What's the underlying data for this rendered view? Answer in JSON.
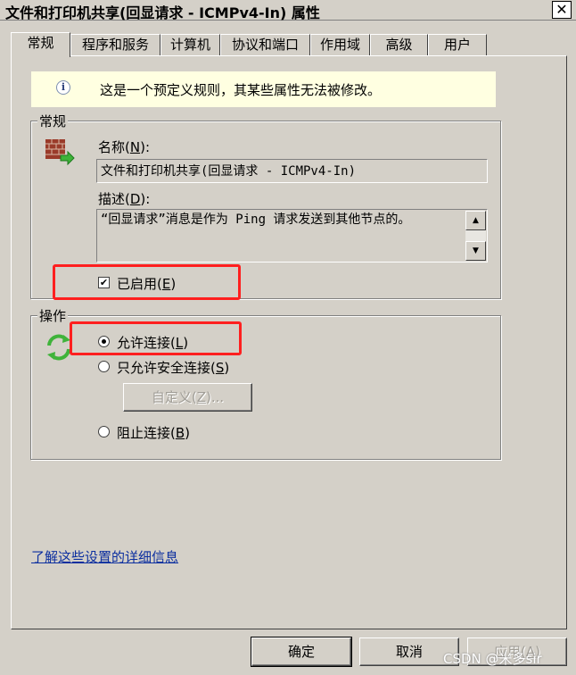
{
  "window": {
    "title": "文件和打印机共享(回显请求 - ICMPv4-In) 属性",
    "close_glyph": "✕"
  },
  "tabs": [
    {
      "label": "常规",
      "active": true
    },
    {
      "label": "程序和服务",
      "active": false
    },
    {
      "label": "计算机",
      "active": false
    },
    {
      "label": "协议和端口",
      "active": false
    },
    {
      "label": "作用域",
      "active": false
    },
    {
      "label": "高级",
      "active": false
    },
    {
      "label": "用户",
      "active": false
    }
  ],
  "info": {
    "icon": "info-icon",
    "icon_glyph": "i",
    "text": "这是一个预定义规则，其某些属性无法被修改。",
    "background": "#ffffe1"
  },
  "general": {
    "group_title": "常规",
    "icon": "firewall-brick-icon",
    "name_label_pre": "名称(",
    "name_label_key": "N",
    "name_label_post": "):",
    "name_value": "文件和打印机共享(回显请求 - ICMPv4-In)",
    "desc_label_pre": "描述(",
    "desc_label_key": "D",
    "desc_label_post": "):",
    "desc_value": "“回显请求”消息是作为 Ping 请求发送到其他节点的。",
    "enabled_checked": true,
    "enabled_check_glyph": "✔",
    "enabled_label_pre": "已启用(",
    "enabled_label_key": "E",
    "enabled_label_post": ")"
  },
  "action": {
    "group_title": "操作",
    "icon": "refresh-arrows-icon",
    "options": [
      {
        "pre": "允许连接(",
        "key": "L",
        "post": ")",
        "checked": true
      },
      {
        "pre": "只允许安全连接(",
        "key": "S",
        "post": ")",
        "checked": false
      },
      {
        "pre": "阻止连接(",
        "key": "B",
        "post": ")",
        "checked": false
      }
    ],
    "customize_pre": "自定义(",
    "customize_key": "Z",
    "customize_post": ")..."
  },
  "link_text": "了解这些设置的详细信息",
  "buttons": {
    "ok": "确定",
    "cancel": "取消",
    "apply_pre": "应用(",
    "apply_key": "A",
    "apply_post": ")"
  },
  "watermark": "CSDN @米多sir",
  "colors": {
    "highlight": "#ff1f1f",
    "link": "#0b2e9f",
    "dialog": "#d4d0c8"
  }
}
